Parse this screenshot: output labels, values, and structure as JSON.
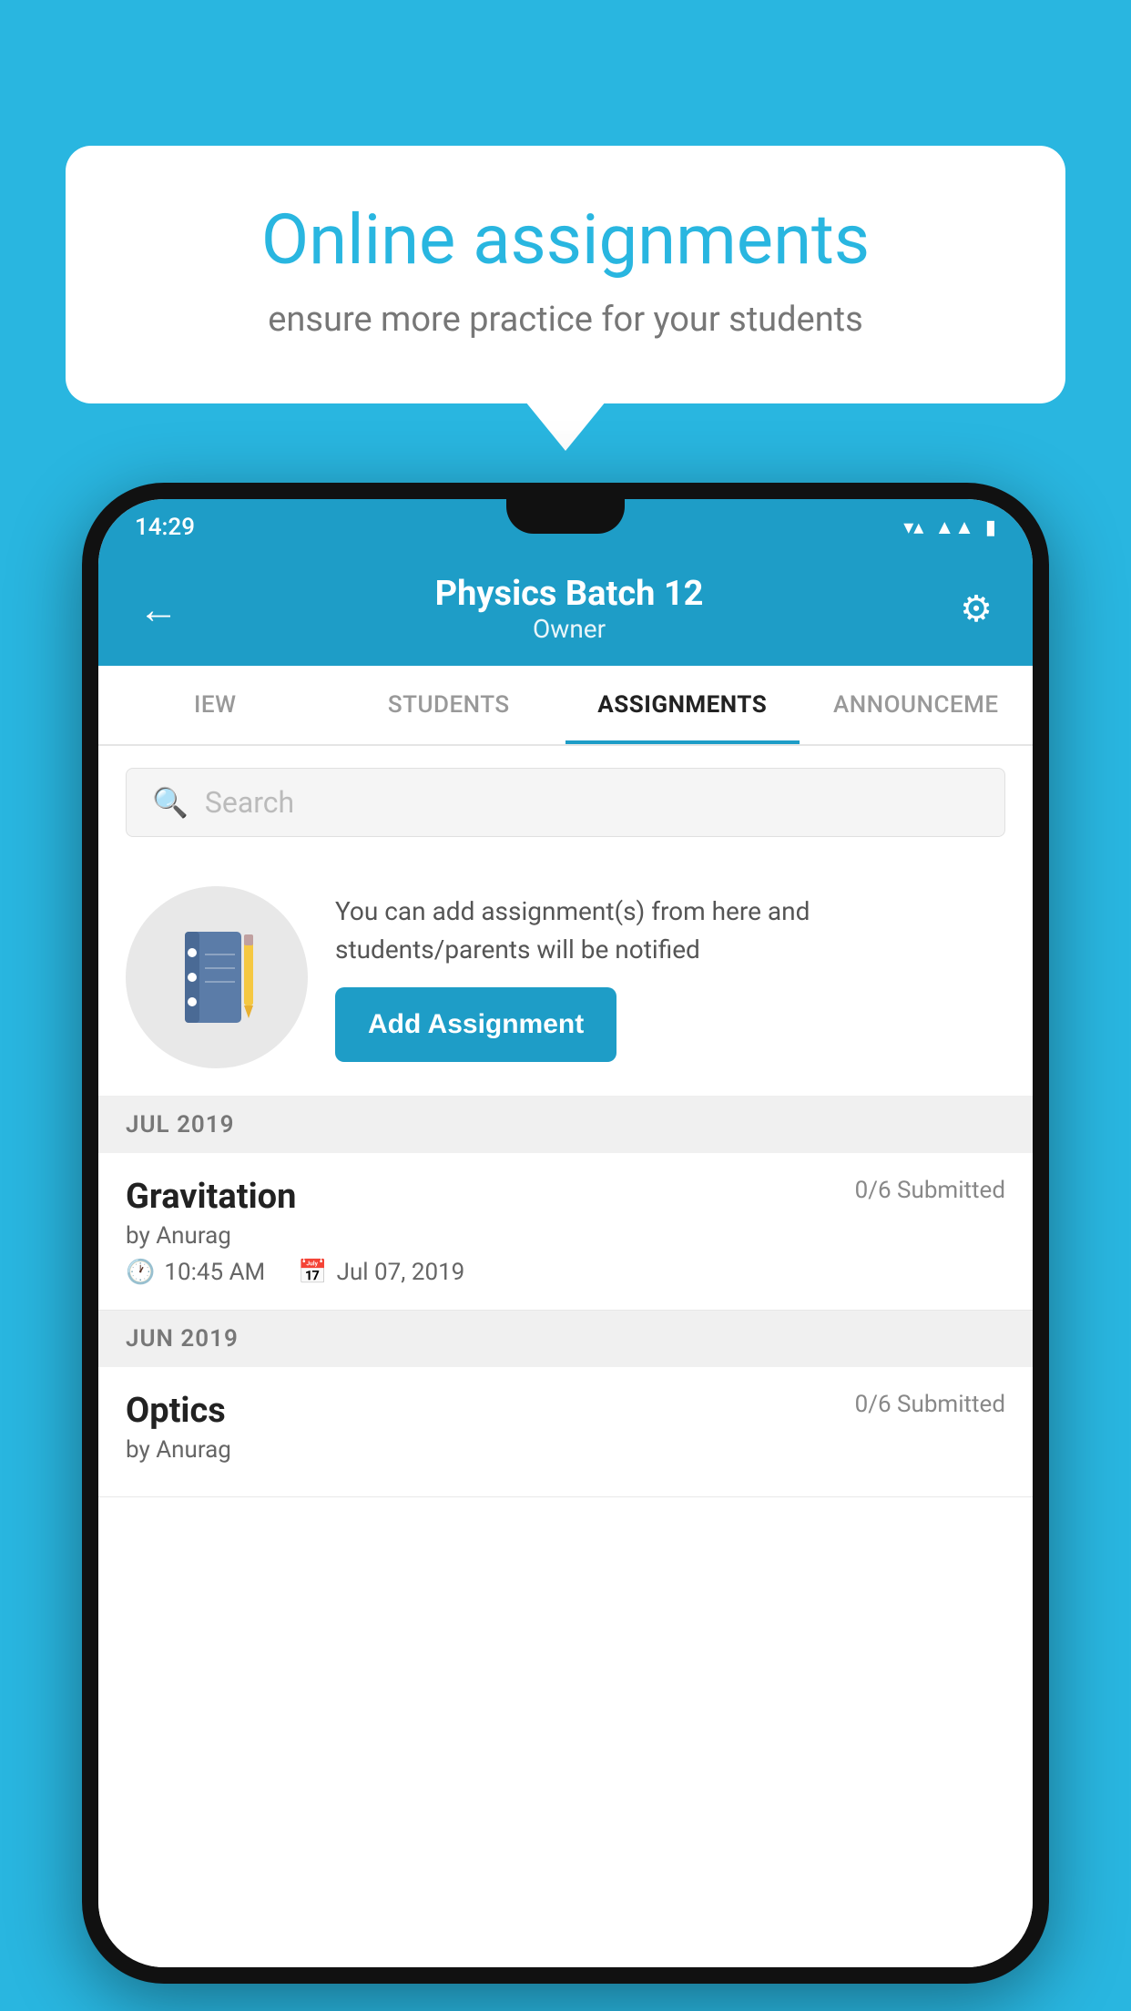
{
  "background_color": "#29b6e0",
  "speech_bubble": {
    "title": "Online assignments",
    "subtitle": "ensure more practice for your students"
  },
  "status_bar": {
    "time": "14:29",
    "icons": [
      "wifi",
      "signal",
      "battery"
    ]
  },
  "header": {
    "title": "Physics Batch 12",
    "subtitle": "Owner",
    "back_label": "←",
    "settings_label": "⚙"
  },
  "tabs": [
    {
      "label": "IEW",
      "active": false
    },
    {
      "label": "STUDENTS",
      "active": false
    },
    {
      "label": "ASSIGNMENTS",
      "active": true
    },
    {
      "label": "ANNOUNCEME",
      "active": false
    }
  ],
  "search": {
    "placeholder": "Search"
  },
  "promo": {
    "description": "You can add assignment(s) from here and students/parents will be notified",
    "button_label": "Add Assignment"
  },
  "sections": [
    {
      "label": "JUL 2019",
      "assignments": [
        {
          "title": "Gravitation",
          "submitted": "0/6 Submitted",
          "author": "by Anurag",
          "time": "10:45 AM",
          "date": "Jul 07, 2019"
        }
      ]
    },
    {
      "label": "JUN 2019",
      "assignments": [
        {
          "title": "Optics",
          "submitted": "0/6 Submitted",
          "author": "by Anurag",
          "time": "",
          "date": ""
        }
      ]
    }
  ]
}
